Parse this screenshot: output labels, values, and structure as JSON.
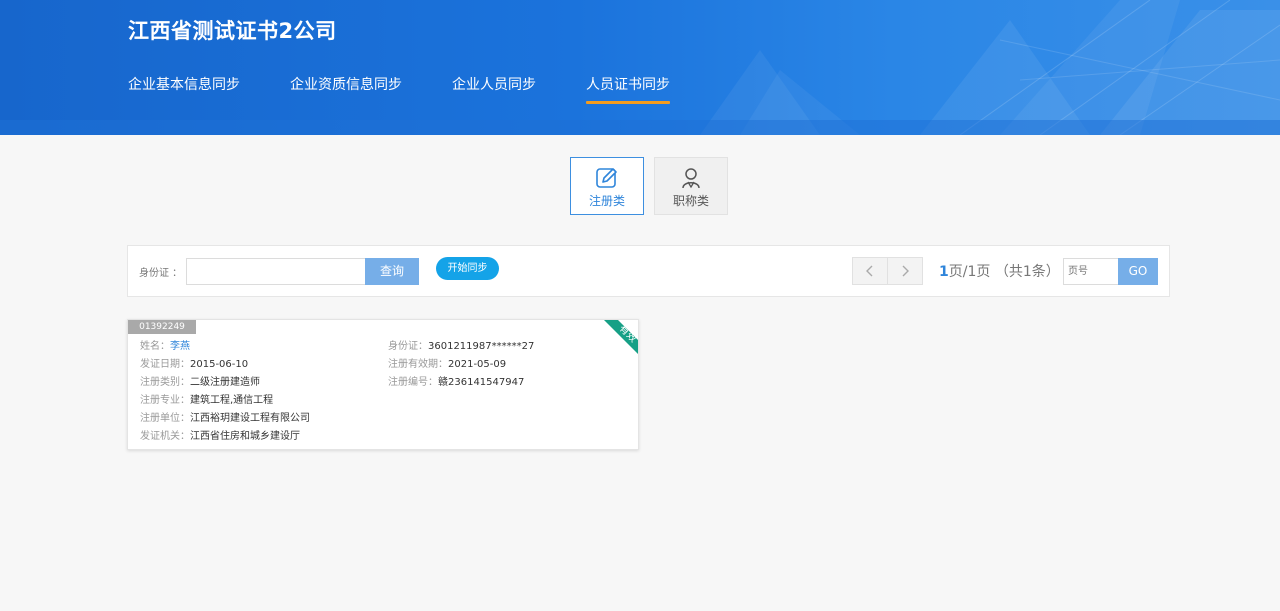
{
  "header": {
    "company": "江西省测试证书2公司",
    "nav": [
      {
        "label": "企业基本信息同步",
        "active": false
      },
      {
        "label": "企业资质信息同步",
        "active": false
      },
      {
        "label": "企业人员同步",
        "active": false
      },
      {
        "label": "人员证书同步",
        "active": true
      }
    ]
  },
  "categories": [
    {
      "label": "注册类",
      "icon": "edit-icon",
      "active": true
    },
    {
      "label": "职称类",
      "icon": "person-icon",
      "active": false
    }
  ],
  "search": {
    "id_label": "身份证 ：",
    "id_value": "",
    "query_label": "查询",
    "sync_label": "开始同步"
  },
  "pagination": {
    "current": "1",
    "info_rest": "页/1页 （共1条）",
    "page_placeholder": "页号",
    "go_label": "GO"
  },
  "card": {
    "tag": "01392249",
    "status": "有效",
    "name_label": "姓名：",
    "name": "李燕",
    "id_label": "身份证：",
    "id": "3601211987******27",
    "issue_date_label": "发证日期：",
    "issue_date": "2015-06-10",
    "valid_label": "注册有效期：",
    "valid": "2021-05-09",
    "type_label": "注册类别：",
    "type": "二级注册建造师",
    "reg_no_label": "注册编号：",
    "reg_no": "赣236141547947",
    "major_label": "注册专业：",
    "major": "建筑工程,通信工程",
    "unit_label": "注册单位：",
    "unit": "江西裕玥建设工程有限公司",
    "issuer_label": "发证机关：",
    "issuer": "江西省住房和城乡建设厅"
  },
  "colors": {
    "header_blue": "#1b73dc",
    "nav_underline": "#f39c1f",
    "accent_blue": "#2f85da",
    "button_blue": "#76aee8",
    "sync_blue": "#14a3e8",
    "ribbon_green": "#16a086"
  }
}
